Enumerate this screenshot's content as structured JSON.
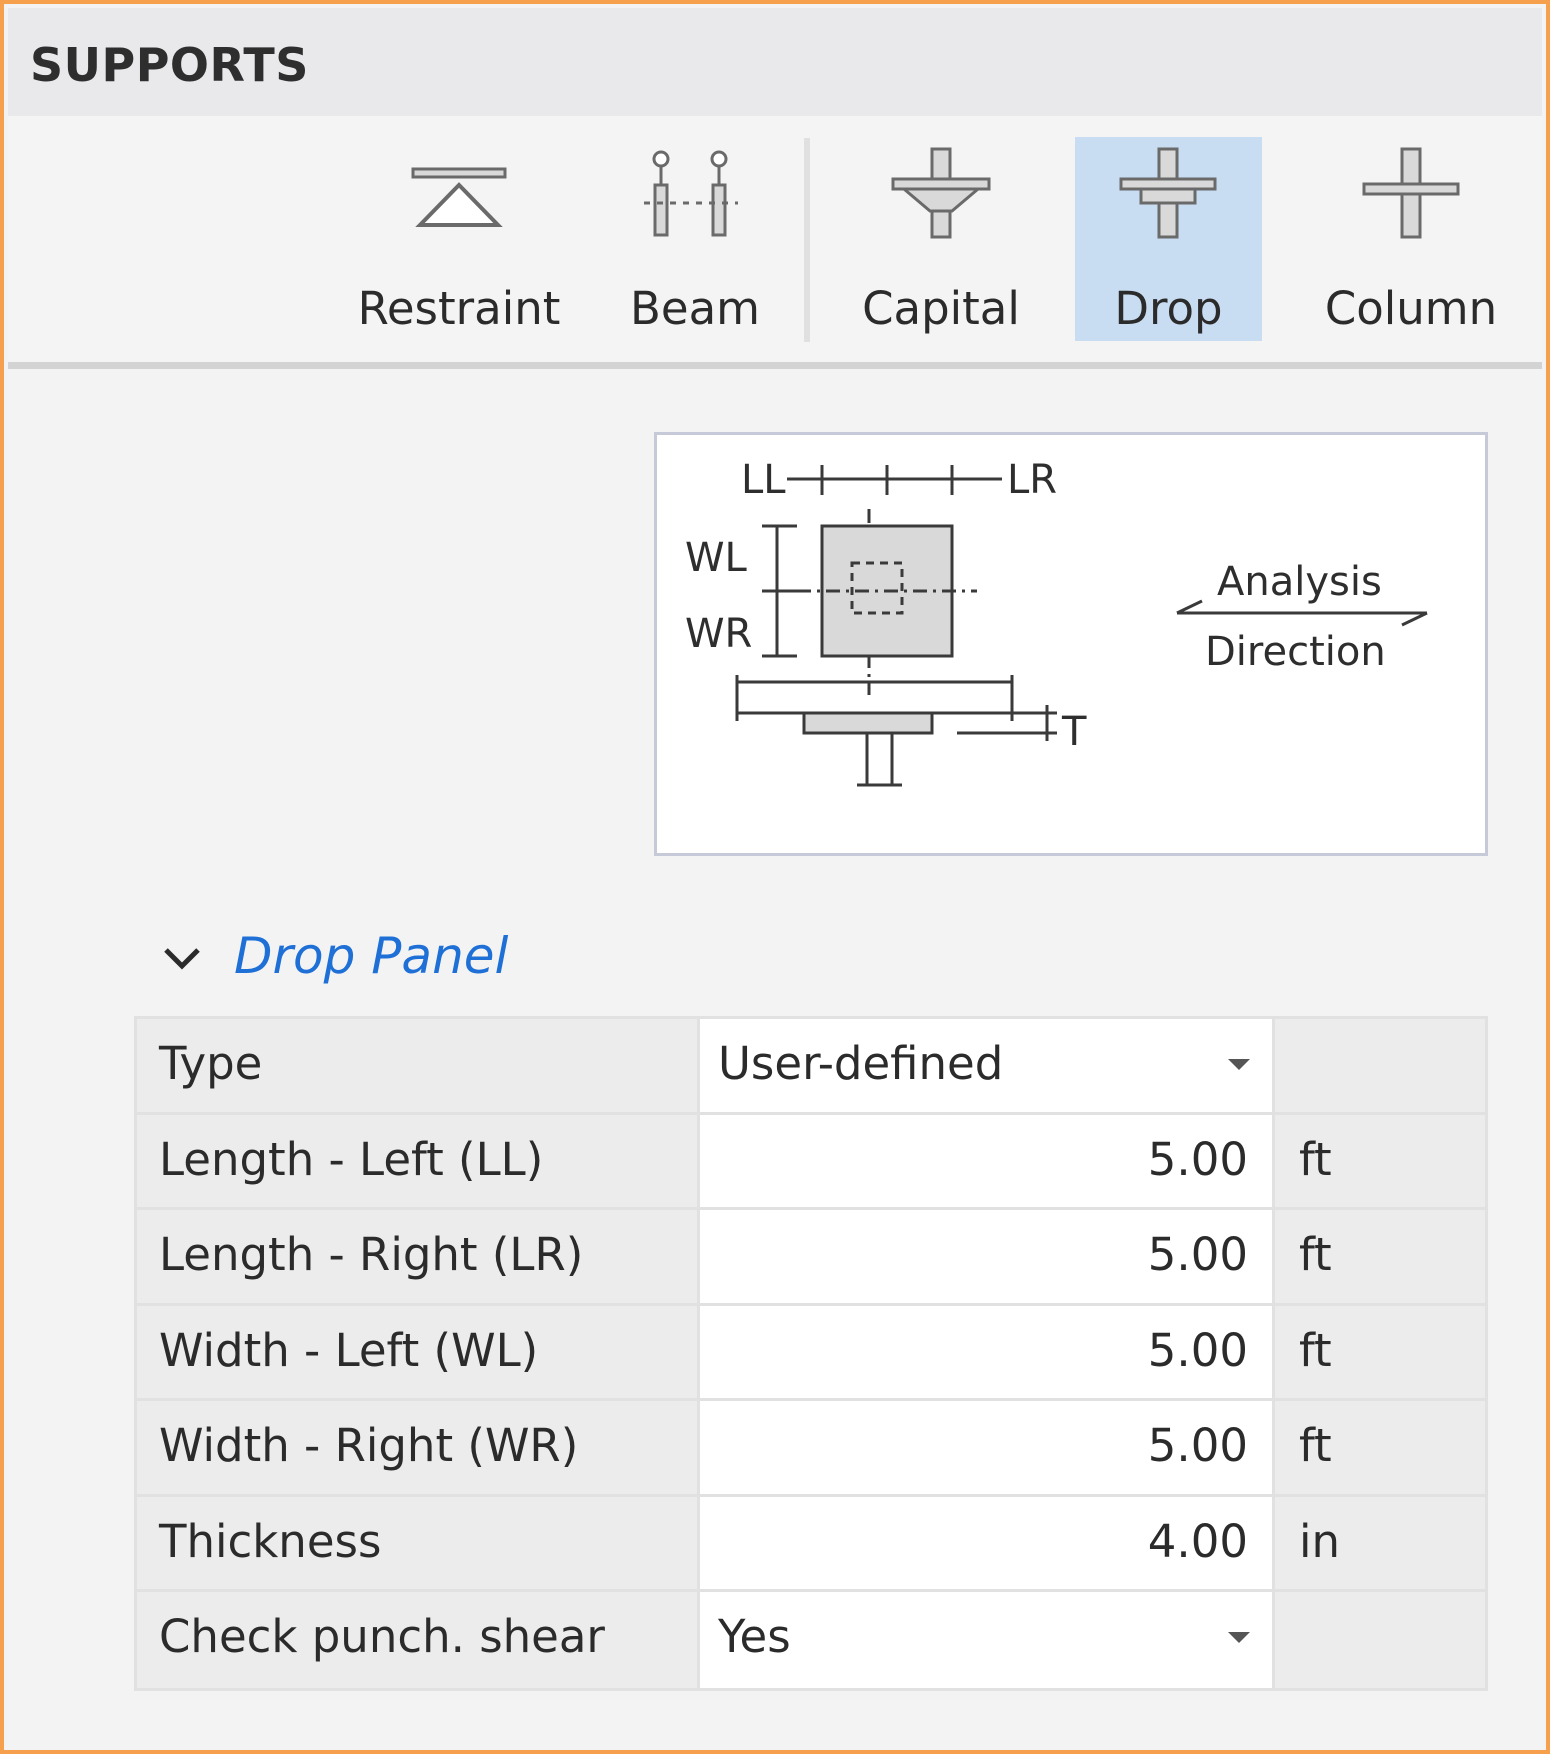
{
  "panel": {
    "title": "SUPPORTS"
  },
  "ribbon": {
    "tools": [
      {
        "label": "Restraint",
        "icon": "restraint-icon",
        "active": false
      },
      {
        "label": "Beam",
        "icon": "beam-support-icon",
        "active": false
      },
      {
        "label": "Capital",
        "icon": "capital-icon",
        "active": false
      },
      {
        "label": "Drop",
        "icon": "drop-panel-icon",
        "active": true
      },
      {
        "label": "Column",
        "icon": "column-icon",
        "active": false
      }
    ],
    "active_color": "#c8dcf2"
  },
  "diagram": {
    "labels": {
      "ll": "LL",
      "lr": "LR",
      "wl": "WL",
      "wr": "WR",
      "t": "T",
      "analysis": "Analysis",
      "direction": "Direction"
    }
  },
  "section": {
    "title": "Drop Panel",
    "expanded": true,
    "title_color": "#1e6fd6"
  },
  "properties": [
    {
      "label": "Type",
      "value": "User-defined",
      "unit": "",
      "kind": "dropdown"
    },
    {
      "label": "Length - Left (LL)",
      "value": "5.00",
      "unit": "ft",
      "kind": "number"
    },
    {
      "label": "Length - Right (LR)",
      "value": "5.00",
      "unit": "ft",
      "kind": "number"
    },
    {
      "label": "Width - Left (WL)",
      "value": "5.00",
      "unit": "ft",
      "kind": "number"
    },
    {
      "label": "Width - Right (WR)",
      "value": "5.00",
      "unit": "ft",
      "kind": "number"
    },
    {
      "label": "Thickness",
      "value": "4.00",
      "unit": "in",
      "kind": "number"
    },
    {
      "label": "Check punch. shear",
      "value": "Yes",
      "unit": "",
      "kind": "dropdown"
    }
  ],
  "colors": {
    "frame_border": "#f6a04d"
  }
}
